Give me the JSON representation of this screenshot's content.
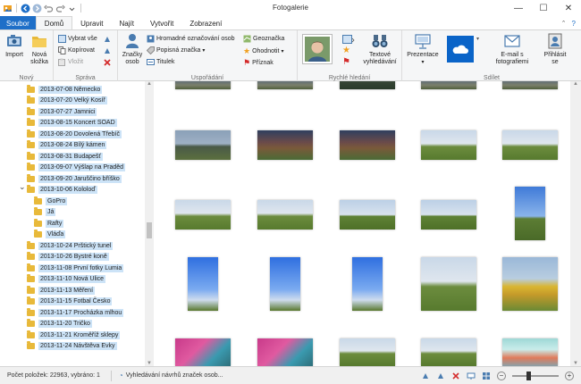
{
  "app": {
    "title": "Fotogalerie",
    "window_controls": {
      "minimize": "—",
      "maximize": "☐",
      "close": "✕"
    }
  },
  "tabs": [
    {
      "label": "Soubor",
      "active": false,
      "file": true
    },
    {
      "label": "Domů",
      "active": true,
      "file": false
    },
    {
      "label": "Upravit",
      "active": false,
      "file": false
    },
    {
      "label": "Najít",
      "active": false,
      "file": false
    },
    {
      "label": "Vytvořit",
      "active": false,
      "file": false
    },
    {
      "label": "Zobrazení",
      "active": false,
      "file": false
    }
  ],
  "ribbon": {
    "novy": {
      "label": "Nový",
      "import": "Import",
      "new_folder_line1": "Nová",
      "new_folder_line2": "složka"
    },
    "sprava": {
      "label": "Správa",
      "select_all": "Vybrat vše",
      "copy": "Kopírovat",
      "paste": "Vložit"
    },
    "usporadani": {
      "label": "Uspořádání",
      "tags_line1": "Značky",
      "tags_line2": "osob",
      "bulk_tagging": "Hromadné označování osob",
      "descriptive_tag": "Popisná značka",
      "caption": "Titulek",
      "geotag": "Geoznačka",
      "rating": "Ohodnotit",
      "flag": "Příznak"
    },
    "rychle_hledani": {
      "label": "Rychlé hledání",
      "text_search_line1": "Textové",
      "text_search_line2": "vyhledávání"
    },
    "sdilet": {
      "label": "Sdílet",
      "slideshow": "Prezentace",
      "email_line1": "E-mail s",
      "email_line2": "fotografiemi",
      "signin_line1": "Přihlásit",
      "signin_line2": "se"
    }
  },
  "nav": {
    "items": [
      {
        "label": "2013-07-08 Německo",
        "level": 1
      },
      {
        "label": "2013-07-20 Velký Kosíř",
        "level": 1
      },
      {
        "label": "2013-07-27 Jamnici",
        "level": 1
      },
      {
        "label": "2013-08-15 Koncert SOAD",
        "level": 1
      },
      {
        "label": "2013-08-20 Dovolená Třebíč",
        "level": 1
      },
      {
        "label": "2013-08-24 Bílý kámen",
        "level": 1
      },
      {
        "label": "2013-08-31 Budapešť",
        "level": 1
      },
      {
        "label": "2013-09-07 Výšlap na Praděd",
        "level": 1
      },
      {
        "label": "2013-09-20 Jaruščino bříško",
        "level": 1
      },
      {
        "label": "2013-10-06 Kololoď",
        "level": 1,
        "expanded": true
      },
      {
        "label": "GoPro",
        "level": 2
      },
      {
        "label": "Já",
        "level": 2
      },
      {
        "label": "Rafty",
        "level": 2
      },
      {
        "label": "Vláďa",
        "level": 2
      },
      {
        "label": "2013-10-24 Prštický tunel",
        "level": 1
      },
      {
        "label": "2013-10-26 Bystré koně",
        "level": 1
      },
      {
        "label": "2013-11-08 První fotky Lumia",
        "level": 1
      },
      {
        "label": "2013-11-10 Nová Ulice",
        "level": 1
      },
      {
        "label": "2013-11-13 Měření",
        "level": 1
      },
      {
        "label": "2013-11-15 Fotbal Česko",
        "level": 1
      },
      {
        "label": "2013-11-17 Procházka mlhou",
        "level": 1
      },
      {
        "label": "2013-11-20 Tričko",
        "level": 1
      },
      {
        "label": "2013-11-21 Kroměříž sklepy",
        "level": 1
      },
      {
        "label": "2013-11-24 Návštěva Evky",
        "level": 1
      }
    ]
  },
  "status": {
    "count": "Počet položek: 22963, vybráno: 1",
    "suggestion": "Vyhledávání návrhů značek osob..."
  },
  "colors": {
    "file_tab": "#1e6fc8",
    "nav_highlight": "#cce3f7",
    "folder": "#e8b93a"
  }
}
